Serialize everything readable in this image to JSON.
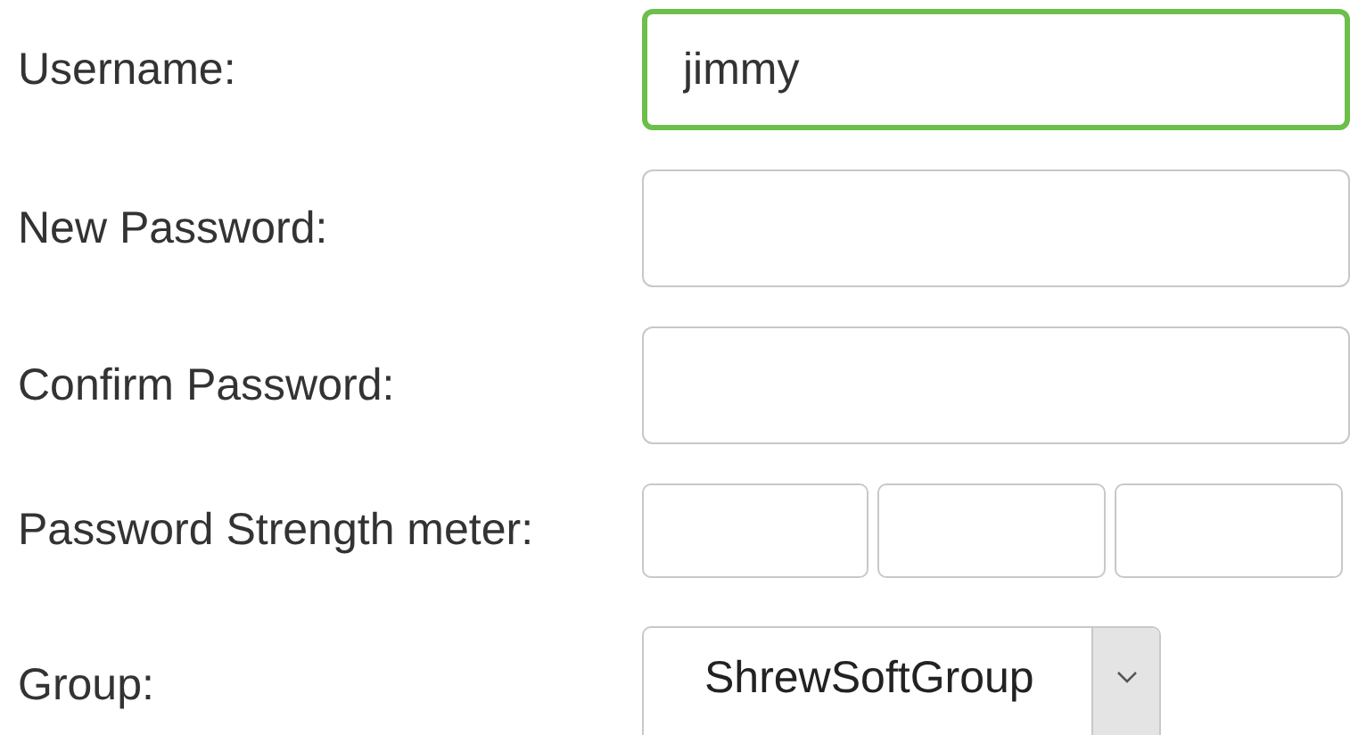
{
  "fields": [
    {
      "kind": "text",
      "label": "Username:",
      "value": "jimmy",
      "focused": true
    },
    {
      "kind": "text",
      "label": "New Password:",
      "focused": false
    },
    {
      "kind": "text",
      "label": "Confirm Password:",
      "focused": false
    },
    {
      "kind": "meter",
      "label": "Password Strength meter:"
    },
    {
      "kind": "select",
      "label": "Group:",
      "value": "ShrewSoftGroup"
    }
  ]
}
